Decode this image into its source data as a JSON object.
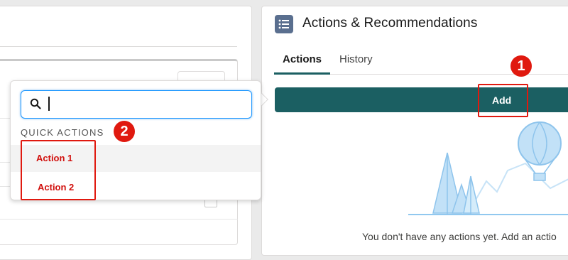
{
  "card": {
    "icon": "list-icon",
    "title": "Actions & Recommendations",
    "tabs": [
      {
        "label": "Actions",
        "active": true
      },
      {
        "label": "History",
        "active": false
      }
    ],
    "add_label": "Add",
    "empty_message": "You don't have any actions yet. Add an actio"
  },
  "popover": {
    "search_value": "",
    "section_header": "QUICK ACTIONS",
    "items": [
      {
        "label": "Action 1"
      },
      {
        "label": "Action 2"
      }
    ]
  },
  "annotations": {
    "badge_1": "1",
    "badge_2": "2",
    "highlight_color": "#e0190f"
  },
  "colors": {
    "brand_teal": "#1b5f62",
    "focus_blue": "#1b96ff",
    "icon_slate": "#5a6f8f"
  }
}
